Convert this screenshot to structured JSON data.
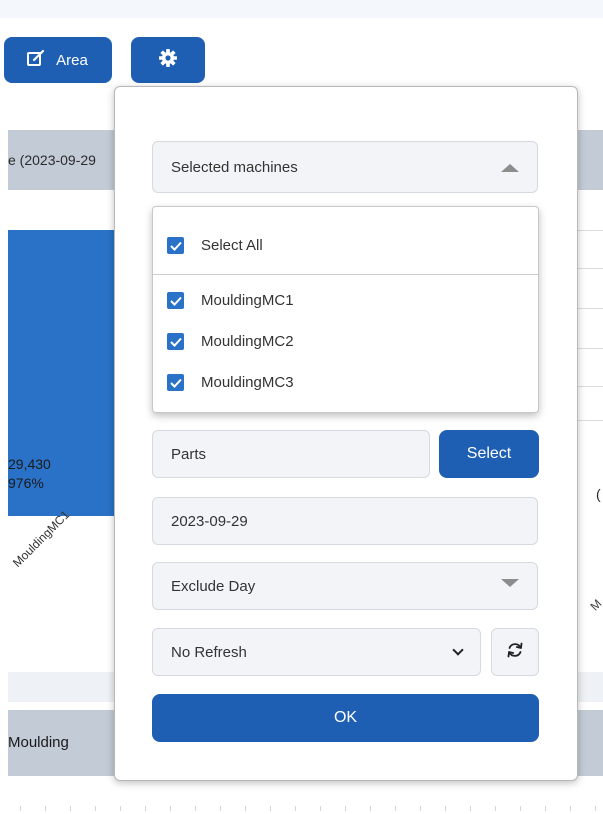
{
  "toolbar": {
    "area_label": "Area",
    "area_icon": "edit-square-icon",
    "settings_icon": "gear-icon",
    "primary_color": "#1e5fb4"
  },
  "background": {
    "header_date_fragment": "e (2023-09-29",
    "bar_value": "29,430",
    "bar_percent": "976%",
    "machine_axis_label": "MouldingMC1",
    "right_fragment": "(",
    "right_axis_fragment": "M",
    "footer_label": "Moulding"
  },
  "panel": {
    "machines_select": {
      "label": "Selected machines",
      "expanded": true,
      "options": [
        {
          "label": "Select All",
          "checked": true
        },
        {
          "label": "MouldingMC1",
          "checked": true
        },
        {
          "label": "MouldingMC2",
          "checked": true
        },
        {
          "label": "MouldingMC3",
          "checked": true
        }
      ]
    },
    "parts": {
      "placeholder": "Parts",
      "select_label": "Select"
    },
    "date_value": "2023-09-29",
    "exclude_day": "Exclude Day",
    "refresh_select": "No Refresh",
    "refresh_icon": "reload-icon",
    "ok_label": "OK"
  }
}
